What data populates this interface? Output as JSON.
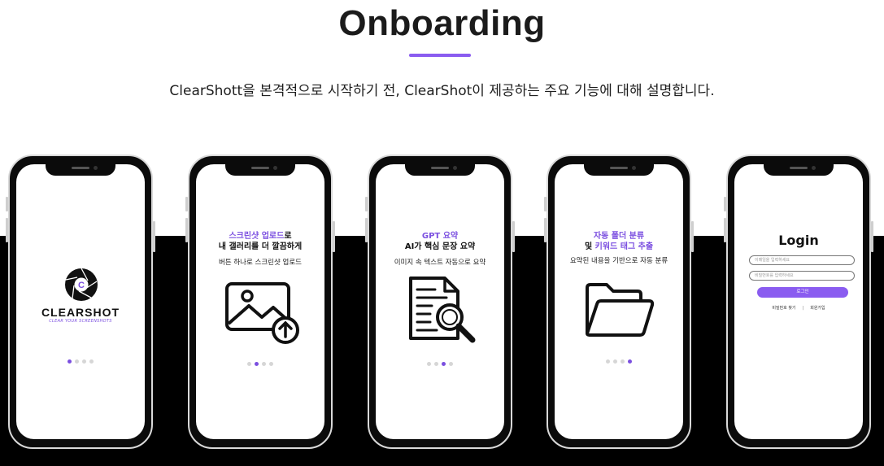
{
  "header": {
    "title": "Onboarding",
    "subtitle": "ClearShott을 본격적으로 시작하기 전, ClearShot이 제공하는 주요 기능에 대해 설명합니다."
  },
  "colors": {
    "accent": "#8a5cf0",
    "dark": "#000000"
  },
  "phones": [
    {
      "logo": "CLEARSHOT",
      "logo_tagline": "CLEAR YOUR SCREENSHOTS",
      "icon": "clearshot-aperture-logo",
      "active_dot": 1
    },
    {
      "heading_accent": "스크린샷 업로드",
      "heading_suffix": "로",
      "heading_line2": "내 갤러리를 더 깔끔하게",
      "description": "버튼 하나로 스크린샷 업로드",
      "icon": "image-upload-icon",
      "active_dot": 2
    },
    {
      "heading_accent": "GPT 요약",
      "heading_line2": "AI가 핵심 문장 요약",
      "description": "이미지 속 텍스트 자동으로 요약",
      "icon": "document-search-icon",
      "active_dot": 3
    },
    {
      "heading_accent": "자동 폴더 분류",
      "heading_line2_prefix": "및 ",
      "heading_line2_accent": "키워드 태그 추출",
      "description": "요약된 내용을 기반으로 자동 분류",
      "icon": "folder-icon",
      "active_dot": 4
    },
    {
      "login_title": "Login",
      "email_placeholder": "이메일을 입력하세요",
      "password_placeholder": "비밀번호를 입력하세요",
      "login_button": "로그인",
      "find_password": "비밀번호 찾기",
      "signup": "회원가입"
    }
  ]
}
